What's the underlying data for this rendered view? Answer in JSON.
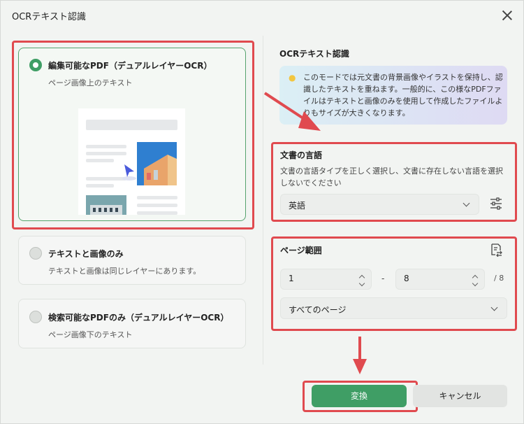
{
  "window": {
    "title": "OCRテキスト認識"
  },
  "options": [
    {
      "title": "編集可能なPDF（デュアルレイヤーOCR）",
      "subtitle": "ページ画像上のテキスト",
      "selected": true
    },
    {
      "title": "テキストと画像のみ",
      "subtitle": "テキストと画像は同じレイヤーにあります。",
      "selected": false
    },
    {
      "title": "検索可能なPDFのみ（デュアルレイヤーOCR）",
      "subtitle": "ページ画像下のテキスト",
      "selected": false
    }
  ],
  "ocr_section": {
    "title": "OCRテキスト認識",
    "info": "このモードでは元文書の背景画像やイラストを保持し、認識したテキストを重ねます。一般的に、この様なPDFファイルはテキストと画像のみを使用して作成したファイルよりもサイズが大きくなります。"
  },
  "language": {
    "title": "文書の言語",
    "description": "文書の言語タイプを正しく選択し、文書に存在しない言語を選択しないでください",
    "selected": "英語"
  },
  "page_range": {
    "title": "ページ範囲",
    "from": "1",
    "separator": "-",
    "to": "8",
    "total": "/ 8",
    "scope": "すべてのページ"
  },
  "buttons": {
    "convert": "変換",
    "cancel": "キャンセル"
  },
  "colors": {
    "accent": "#3f9e65",
    "highlight": "#e04a4f",
    "info_start": "#dbeff5",
    "info_end": "#dedaf3"
  }
}
